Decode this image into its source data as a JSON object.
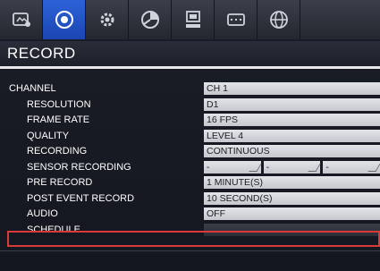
{
  "toolbar": {
    "buttons": [
      {
        "icon": "camera-settings-icon",
        "active": false
      },
      {
        "icon": "record-icon",
        "active": true
      },
      {
        "icon": "gear-icon",
        "active": false
      },
      {
        "icon": "event-icon",
        "active": false
      },
      {
        "icon": "network-icon",
        "active": false
      },
      {
        "icon": "display-icon",
        "active": false
      },
      {
        "icon": "globe-icon",
        "active": false
      }
    ],
    "accent_color": "#2d63d8"
  },
  "section": {
    "title": "RECORD"
  },
  "settings": {
    "channel": {
      "label": "CHANNEL",
      "value": "CH 1"
    },
    "resolution": {
      "label": "RESOLUTION",
      "value": "D1"
    },
    "frame_rate": {
      "label": "FRAME RATE",
      "value": "16 FPS"
    },
    "quality": {
      "label": "QUALITY",
      "value": "LEVEL 4"
    },
    "recording": {
      "label": "RECORDING",
      "value": "CONTINUOUS"
    },
    "sensor_recording": {
      "label": "SENSOR RECORDING",
      "values": [
        "-",
        "-",
        "-"
      ]
    },
    "pre_record": {
      "label": "PRE RECORD",
      "value": "1 MINUTE(S)"
    },
    "post_event_record": {
      "label": "POST EVENT RECORD",
      "value": "10 SECOND(S)"
    },
    "audio": {
      "label": "AUDIO",
      "value": "OFF"
    },
    "schedule": {
      "label": "SCHEDULE",
      "value": "..."
    }
  },
  "highlight_color": "#d83a3a"
}
